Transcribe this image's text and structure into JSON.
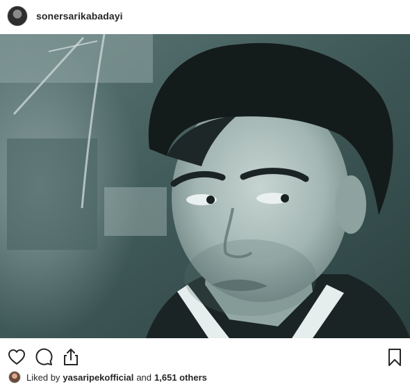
{
  "header": {
    "username": "sonersarikabadayi"
  },
  "post": {
    "image_icon": "portrait-photo"
  },
  "actions": {
    "like_icon": "heart-icon",
    "comment_icon": "comment-icon",
    "share_icon": "share-icon",
    "save_icon": "bookmark-icon"
  },
  "likes": {
    "prefix": "Liked by",
    "user": "yasaripekofficial",
    "connector": "and",
    "count": "1,651 others"
  }
}
